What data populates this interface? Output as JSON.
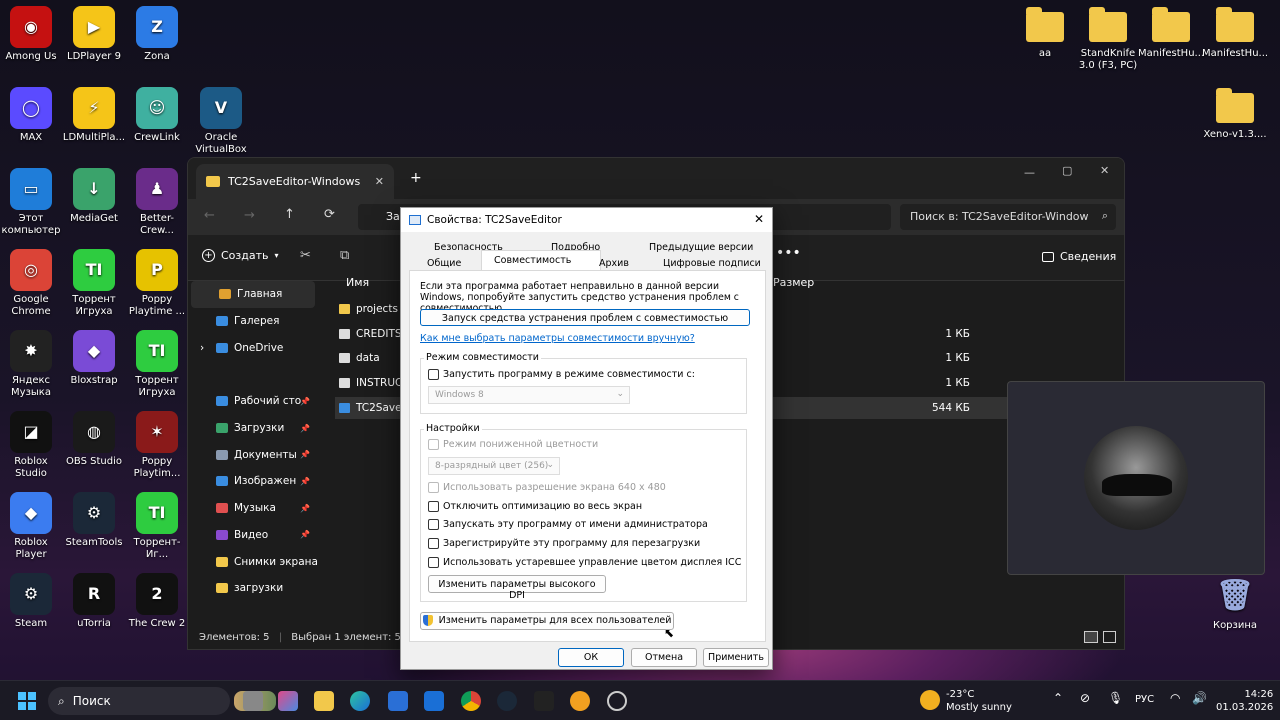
{
  "desktop_icons_left": [
    {
      "label": "Among Us",
      "color": "#c51111",
      "glyph": "◉"
    },
    {
      "label": "LDPlayer 9",
      "color": "#f5c518",
      "glyph": "▶"
    },
    {
      "label": "Zona",
      "color": "#2c7be5",
      "glyph": "Z"
    },
    {
      "label": "MAX",
      "color": "#5b4bff",
      "glyph": "◯"
    },
    {
      "label": "LDMultiPla...",
      "color": "#f5c518",
      "glyph": "⚡"
    },
    {
      "label": "CrewLink",
      "color": "#3fb0a0",
      "glyph": "☺"
    },
    {
      "label": "Oracle VirtualBox",
      "color": "#1c5a86",
      "glyph": "V"
    },
    {
      "label": "Этот компьютер",
      "color": "#1f7dd9",
      "glyph": "▭"
    },
    {
      "label": "MediaGet",
      "color": "#3aa36b",
      "glyph": "↓"
    },
    {
      "label": "Better-Crew...",
      "color": "#6a2c8a",
      "glyph": "♟"
    },
    {
      "label": "Google Chrome",
      "color": "#db4437",
      "glyph": "◎"
    },
    {
      "label": "Торрент Игруха",
      "color": "#2ecc40",
      "glyph": "TI"
    },
    {
      "label": "Poppy Playtime ...",
      "color": "#e6c200",
      "glyph": "P"
    },
    {
      "label": "Яндекс Музыка",
      "color": "#222222",
      "glyph": "✸"
    },
    {
      "label": "Bloxstrap",
      "color": "#7a4bd6",
      "glyph": "◆"
    },
    {
      "label": "Торрент Игруха",
      "color": "#2ecc40",
      "glyph": "TI"
    },
    {
      "label": "Roblox Studio",
      "color": "#111111",
      "glyph": "◪"
    },
    {
      "label": "OBS Studio",
      "color": "#1a1a1a",
      "glyph": "◍"
    },
    {
      "label": "Poppy Playtim...",
      "color": "#8a1a1a",
      "glyph": "✶"
    },
    {
      "label": "Roblox Player",
      "color": "#3b7cf0",
      "glyph": "◆"
    },
    {
      "label": "SteamTools",
      "color": "#1b2838",
      "glyph": "⚙"
    },
    {
      "label": "Торрент-Иг...",
      "color": "#2ecc40",
      "glyph": "TI"
    },
    {
      "label": "Steam",
      "color": "#1b2838",
      "glyph": "⚙"
    },
    {
      "label": "uTorria",
      "color": "#111111",
      "glyph": "R"
    },
    {
      "label": "The Crew 2",
      "color": "#111111",
      "glyph": "2"
    }
  ],
  "desktop_icons_right": [
    {
      "label": "aa"
    },
    {
      "label": "StandKnife 3.0 (F3, PC)"
    },
    {
      "label": "ManifestHu..."
    },
    {
      "label": "ManifestHu..."
    },
    {
      "label": "Xeno-v1.3...."
    }
  ],
  "recycle_bin": {
    "label": "Корзина"
  },
  "explorer": {
    "tab_title": "TC2SaveEditor-Windows",
    "address_fragment": "Загр",
    "search_placeholder": "Поиск в: TC2SaveEditor-Window",
    "new_button": "Создать",
    "details_button": "Сведения",
    "nav": [
      {
        "label": "Главная",
        "color": "#e0a030",
        "selected": true,
        "pinned": false
      },
      {
        "label": "Галерея",
        "color": "#3a8de0",
        "selected": false,
        "pinned": false
      },
      {
        "label": "OneDrive",
        "color": "#3a8de0",
        "selected": false,
        "pinned": false
      },
      {
        "label": "Рабочий сто",
        "color": "#3a8de0",
        "selected": false,
        "pinned": true
      },
      {
        "label": "Загрузки",
        "color": "#3aa36b",
        "selected": false,
        "pinned": true
      },
      {
        "label": "Документы",
        "color": "#8a9ab0",
        "selected": false,
        "pinned": true
      },
      {
        "label": "Изображен",
        "color": "#3a8de0",
        "selected": false,
        "pinned": true
      },
      {
        "label": "Музыка",
        "color": "#e05050",
        "selected": false,
        "pinned": true
      },
      {
        "label": "Видео",
        "color": "#8a4ad0",
        "selected": false,
        "pinned": true
      },
      {
        "label": "Снимки экрана",
        "color": "#f2c84b",
        "selected": false,
        "pinned": false
      },
      {
        "label": "загрузки",
        "color": "#f2c84b",
        "selected": false,
        "pinned": false
      }
    ],
    "col_name": "Имя",
    "col_size": "Размер",
    "files": [
      {
        "name": "projects",
        "size": "",
        "type": "folder"
      },
      {
        "name": "CREDITS",
        "size": "1 КБ",
        "type": "file"
      },
      {
        "name": "data",
        "size": "1 КБ",
        "type": "file"
      },
      {
        "name": "INSTRUCTI",
        "size": "1 КБ",
        "type": "file"
      },
      {
        "name": "TC2SaveEd",
        "size": "544 КБ",
        "type": "exe"
      }
    ],
    "status_count": "Элементов: 5",
    "status_selected": "Выбран 1 элемент: 543 КБ"
  },
  "dialog": {
    "title": "Свойства: TC2SaveEditor",
    "tabs_row1": [
      "Безопасность",
      "Подробно",
      "Предыдущие версии"
    ],
    "tabs_row2": [
      "Общие",
      "Совместимость",
      "Архив",
      "Цифровые подписи"
    ],
    "intro": "Если эта программа работает неправильно в данной версии Windows, попробуйте запустить средство устранения проблем с совместимостью.",
    "troubleshooter_button": "Запуск средства устранения проблем с совместимостью",
    "manual_link": "Как мне выбрать параметры совместимости вручную?",
    "compat_group": "Режим совместимости",
    "compat_checkbox": "Запустить программу в режиме совместимости с:",
    "compat_os": "Windows 8",
    "settings_group": "Настройки",
    "reduced_color": "Режим пониженной цветности",
    "color_depth": "8-разрядный цвет (256)",
    "res_640": "Использовать разрешение экрана 640 x 480",
    "fullscreen_opt": "Отключить оптимизацию во весь экран",
    "run_admin": "Запускать эту программу от имени администратора",
    "register_restart": "Зарегистрируйте эту программу для перезагрузки",
    "legacy_icc": "Использовать устаревшее управление цветом дисплея ICC",
    "dpi_button": "Изменить параметры высокого DPI",
    "all_users_button": "Изменить параметры для всех пользователей",
    "ok": "ОК",
    "cancel": "Отмена",
    "apply": "Применить"
  },
  "taskbar": {
    "search": "Поиск",
    "weather_temp": "-23°C",
    "weather_desc": "Mostly sunny",
    "lang": "РУС",
    "time": "14:26",
    "date": "01.03.2026"
  }
}
